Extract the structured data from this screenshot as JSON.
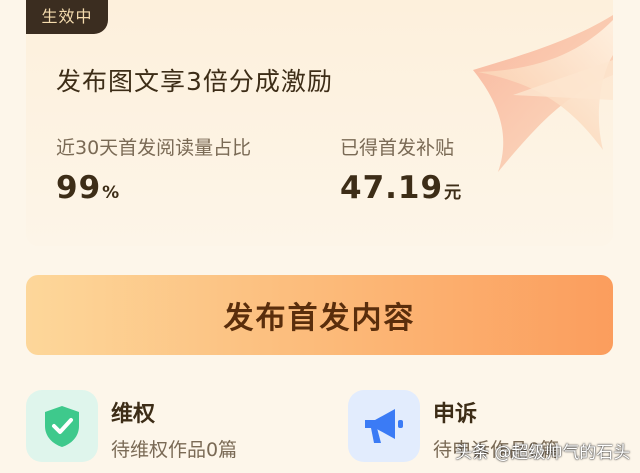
{
  "card": {
    "badge": "生效中",
    "headline": "发布图文享3倍分成激励",
    "stats": [
      {
        "label": "近30天首发阅读量占比",
        "value": "99",
        "unit": "%"
      },
      {
        "label": "已得首发补贴",
        "value": "47.19",
        "unit": "元"
      }
    ]
  },
  "publish_button": "发布首发内容",
  "features": [
    {
      "title": "维权",
      "subtitle": "待维权作品0篇",
      "icon": "shield-check-icon",
      "color": "#3ec98c"
    },
    {
      "title": "申诉",
      "subtitle": "待申诉作品0篇",
      "icon": "megaphone-icon",
      "color": "#3b7bf5"
    }
  ],
  "watermark": "头条 @超级帅气的石头",
  "colors": {
    "accent": "#fb9d5d",
    "background": "#fdf6ea",
    "badge": "#3b2d20"
  }
}
